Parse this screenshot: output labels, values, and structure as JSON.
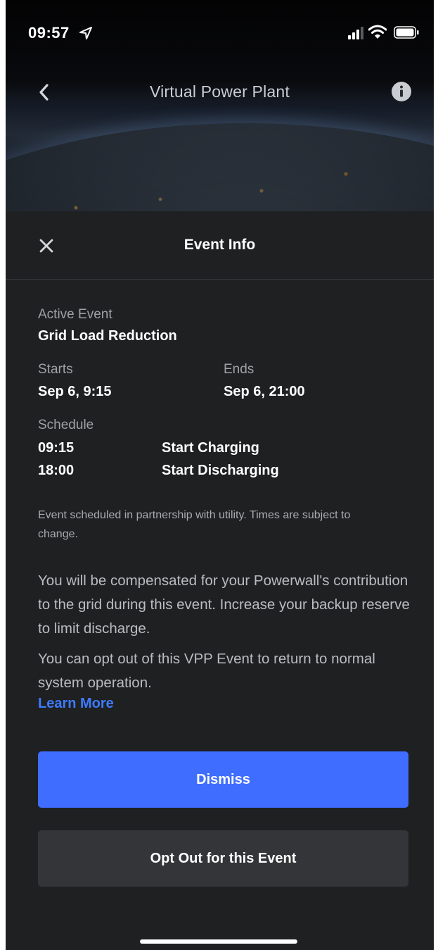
{
  "status_bar": {
    "time": "09:57",
    "location_icon": "location-arrow-icon",
    "signal_icon": "cellular-signal-icon",
    "wifi_icon": "wifi-icon",
    "battery_icon": "battery-icon"
  },
  "nav": {
    "title": "Virtual Power Plant",
    "back_icon": "chevron-left-icon",
    "info_icon": "info-icon"
  },
  "sheet": {
    "title": "Event Info",
    "close_icon": "close-icon"
  },
  "event": {
    "active_label": "Active Event",
    "active_value": "Grid Load Reduction",
    "starts_label": "Starts",
    "starts_value": "Sep 6, 9:15",
    "ends_label": "Ends",
    "ends_value": "Sep 6, 21:00",
    "schedule_label": "Schedule",
    "schedule": [
      {
        "time": "09:15",
        "action": "Start Charging"
      },
      {
        "time": "18:00",
        "action": "Start Discharging"
      }
    ],
    "note": "Event scheduled in partnership with utility. Times are subject to change.",
    "compensation_text": "You will be compensated for your Powerwall's contribution to the grid during this event. Increase your backup reserve to limit discharge.",
    "opt_out_text": "You can opt out of this VPP Event to return to normal system operation.",
    "learn_more": "Learn More"
  },
  "buttons": {
    "dismiss": "Dismiss",
    "opt_out": "Opt Out for this Event"
  },
  "colors": {
    "background": "#1f2022",
    "primary_button": "#3e6dff",
    "secondary_button": "#343538",
    "link": "#3d7bff"
  }
}
